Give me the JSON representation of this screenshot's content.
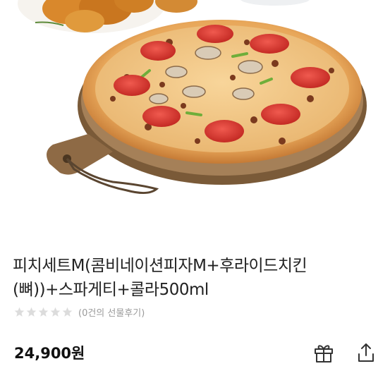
{
  "product": {
    "title_line1": "피치세트M(콤비네이션피자M+후라이드치킨",
    "title_line2": "(뼈))+스파게티+콜라500ml",
    "rating_stars": 0,
    "rating_max": 5,
    "review_text": "(0건의 선물후기)",
    "price": "24,900원"
  },
  "actions": {
    "gift_icon": "gift-icon",
    "share_icon": "share-icon"
  },
  "colors": {
    "star_empty": "#dcdcdc",
    "price_text": "#111111",
    "muted_text": "#9a9a9a"
  }
}
